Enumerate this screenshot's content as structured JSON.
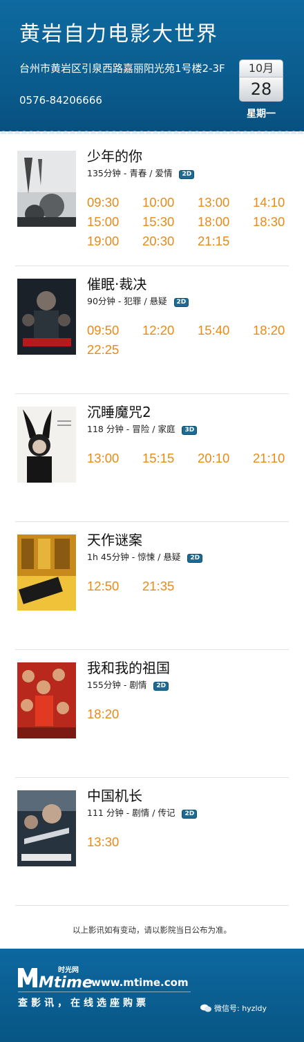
{
  "header": {
    "title": "黄岩自力电影大世界",
    "address": "台州市黄岩区引泉西路嘉丽阳光苑1号楼2-3F",
    "phone": "0576-84206666",
    "date": {
      "month": "10月",
      "day": "28",
      "weekday": "星期一"
    }
  },
  "colors": {
    "header_blue": "#0b5f93",
    "showtime_orange": "#e98a16",
    "badge_blue": "#1e6a92"
  },
  "movies": [
    {
      "title": "少年的你",
      "info": "135分钟 - 青春 / 爱情",
      "format": "2D",
      "times": [
        "09:30",
        "10:00",
        "13:00",
        "14:10",
        "15:00",
        "15:30",
        "18:00",
        "18:30",
        "19:00",
        "20:30",
        "21:15"
      ]
    },
    {
      "title": "催眠·裁决",
      "info": "90分钟 - 犯罪 / 悬疑",
      "format": "2D",
      "times": [
        "09:50",
        "12:20",
        "15:40",
        "18:20",
        "22:25"
      ]
    },
    {
      "title": "沉睡魔咒2",
      "info": "118 分钟 - 冒险 / 家庭",
      "format": "3D",
      "times": [
        "13:00",
        "15:15",
        "20:10",
        "21:10"
      ]
    },
    {
      "title": "天作谜案",
      "info": "1h 45分钟 - 惊悚 / 悬疑",
      "format": "2D",
      "times": [
        "12:50",
        "21:35"
      ]
    },
    {
      "title": "我和我的祖国",
      "info": "155分钟 - 剧情",
      "format": "2D",
      "times": [
        "18:20"
      ]
    },
    {
      "title": "中国机长",
      "info": "111 分钟 - 剧情 / 传记",
      "format": "2D",
      "times": [
        "13:30"
      ]
    }
  ],
  "notice": "以上影讯如有变动，请以影院当日公布为准。",
  "footer": {
    "logo_text": "Mtime",
    "logo_cn": "时光网",
    "site": "www.mtime.com",
    "slogan": "查影讯，在线选座购票",
    "wechat": "微信号: hyzldy"
  }
}
